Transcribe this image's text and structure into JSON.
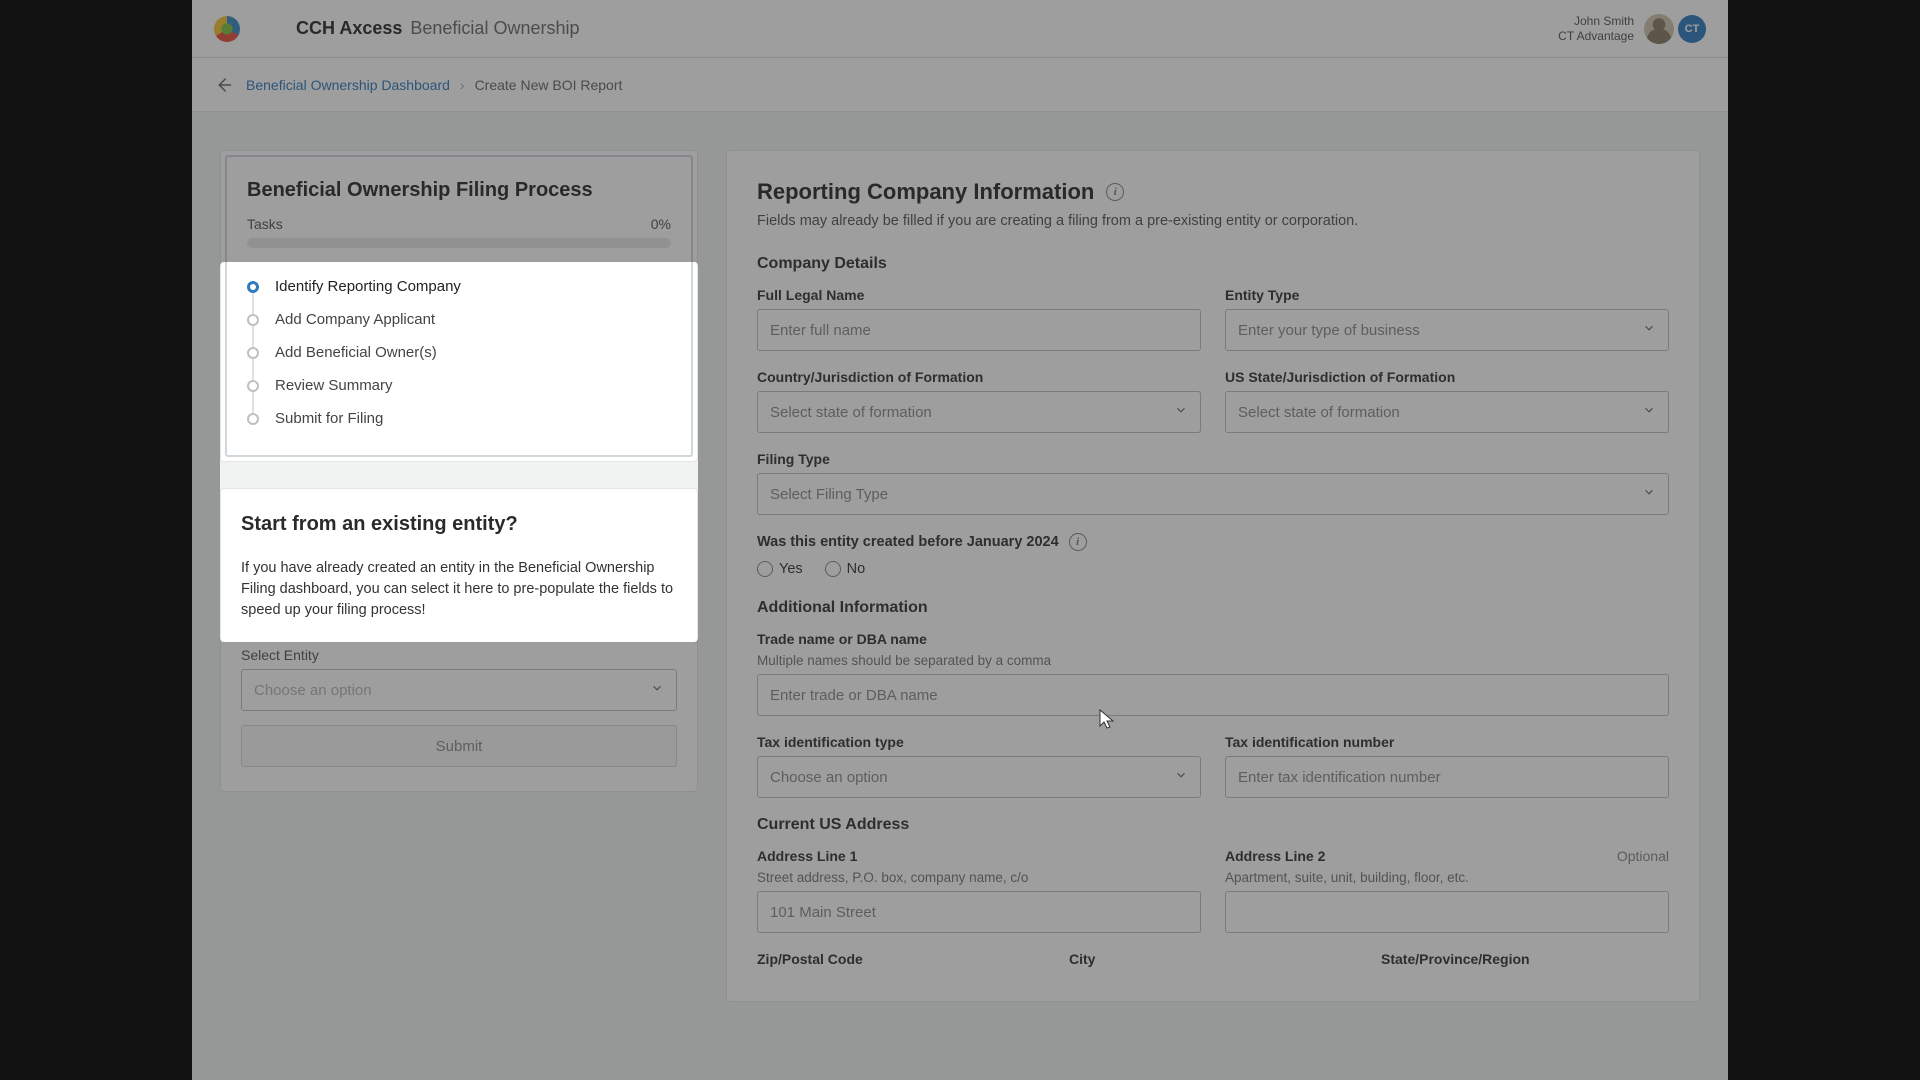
{
  "header": {
    "brand_bold": "CCH Axcess",
    "brand_sub": "Beneficial Ownership",
    "user_name": "John Smith",
    "user_org": "CT Advantage",
    "ct_badge": "CT"
  },
  "breadcrumb": {
    "link": "Beneficial Ownership Dashboard",
    "current": "Create New BOI Report"
  },
  "stepper": {
    "title": "Beneficial Ownership Filing Process",
    "tasks_label": "Tasks",
    "percent": "0%",
    "steps": [
      "Identify Reporting Company",
      "Add Company Applicant",
      "Add Beneficial Owner(s)",
      "Review Summary",
      "Submit for Filing"
    ]
  },
  "entity": {
    "title": "Start from an existing entity?",
    "body": "If you have already created an entity in the Beneficial Ownership Filing dashboard, you can select it here to pre-populate the fields to speed up your filing process!",
    "select_label": "Select Entity",
    "select_ph": "Choose an option",
    "submit": "Submit"
  },
  "form": {
    "title": "Reporting Company Information",
    "desc": "Fields may already be filled if you are creating a filing from a pre-existing entity or corporation.",
    "s1": "Company Details",
    "full_name_label": "Full Legal Name",
    "full_name_ph": "Enter full name",
    "entity_type_label": "Entity Type",
    "entity_type_ph": "Enter your type of business",
    "country_label": "Country/Jurisdiction of Formation",
    "country_ph": "Select state of formation",
    "state_label": "US State/Jurisdiction of Formation",
    "state_ph": "Select state of formation",
    "filing_label": "Filing Type",
    "filing_ph": "Select Filing Type",
    "q_2024": "Was this entity created before January 2024",
    "yes": "Yes",
    "no": "No",
    "s2": "Additional Information",
    "trade_label": "Trade name or DBA name",
    "trade_hint": "Multiple names should be separated by a comma",
    "trade_ph": "Enter trade or DBA name",
    "tax_type_label": "Tax identification type",
    "tax_type_ph": "Choose an option",
    "tax_num_label": "Tax identification number",
    "tax_num_ph": "Enter tax identification number",
    "s3": "Current US Address",
    "addr1_label": "Address Line 1",
    "addr1_hint": "Street address, P.O. box, company name, c/o",
    "addr1_ph": "101 Main Street",
    "addr2_label": "Address Line 2",
    "addr2_opt": "Optional",
    "addr2_hint": "Apartment, suite, unit, building, floor, etc.",
    "zip_label": "Zip/Postal Code",
    "city_label": "City",
    "region_label": "State/Province/Region"
  }
}
